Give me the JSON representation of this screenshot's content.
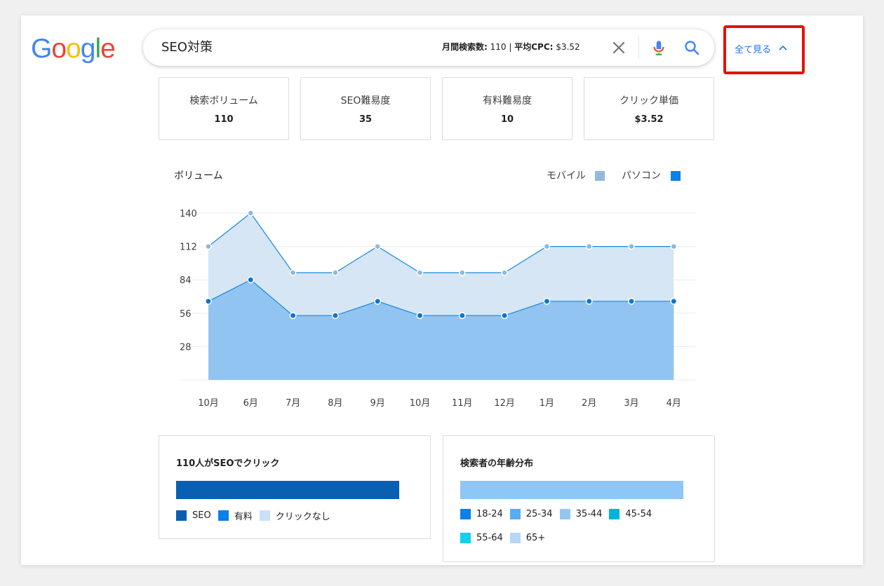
{
  "logo": {
    "text": "Google"
  },
  "search": {
    "query": "SEO対策",
    "monthly_label": "月間検索数:",
    "monthly_value": "110",
    "sep": "|",
    "cpc_label": "平均CPC:",
    "cpc_value": "$3.52"
  },
  "see_all": {
    "label": "全て見る"
  },
  "stats": [
    {
      "label": "検索ボリューム",
      "value": "110"
    },
    {
      "label": "SEO難易度",
      "value": "35"
    },
    {
      "label": "有料難易度",
      "value": "10"
    },
    {
      "label": "クリック単価",
      "value": "$3.52"
    }
  ],
  "legend": {
    "mobile": "モバイル",
    "pc": "パソコン"
  },
  "colors": {
    "mobile_fill": "#d6e6f4",
    "mobile_line": "#1a88db",
    "mobile_point": "#90b8d8",
    "pc_fill": "#91c4f1",
    "pc_point": "#1173d4",
    "legend_mobile": "#94b9dc",
    "legend_pc": "#0b80ea",
    "highlight": "#e0140c"
  },
  "chart_data": {
    "type": "area",
    "title": "ボリューム",
    "categories": [
      "10月",
      "6月",
      "7月",
      "8月",
      "9月",
      "10月",
      "11月",
      "12月",
      "1月",
      "2月",
      "3月",
      "4月"
    ],
    "ylim": [
      0,
      140
    ],
    "yticks": [
      28,
      56,
      84,
      112,
      140
    ],
    "grid": true,
    "legend_position": "top-right",
    "series": [
      {
        "name": "モバイル",
        "values": [
          112,
          140,
          90,
          90,
          112,
          90,
          90,
          90,
          112,
          112,
          112,
          112
        ]
      },
      {
        "name": "パソコン",
        "values": [
          66,
          84,
          54,
          54,
          66,
          54,
          54,
          54,
          66,
          66,
          66,
          66
        ]
      }
    ]
  },
  "clicks": {
    "title": "110人がSEOでクリック",
    "bar_color": "#0b5fb0",
    "legend": [
      {
        "label": "SEO",
        "color": "#0b5fb0"
      },
      {
        "label": "有料",
        "color": "#0b80ea"
      },
      {
        "label": "クリックなし",
        "color": "#c9e1f6"
      }
    ]
  },
  "age": {
    "title": "検索者の年齢分布",
    "bar_color": "#8ec6f6",
    "legend": [
      {
        "label": "18-24",
        "color": "#0b80ea"
      },
      {
        "label": "25-34",
        "color": "#5aacf0"
      },
      {
        "label": "35-44",
        "color": "#93c7f3"
      },
      {
        "label": "45-54",
        "color": "#00b4e0"
      },
      {
        "label": "55-64",
        "color": "#10d1ef"
      },
      {
        "label": "65+",
        "color": "#b6d7f5"
      }
    ]
  }
}
